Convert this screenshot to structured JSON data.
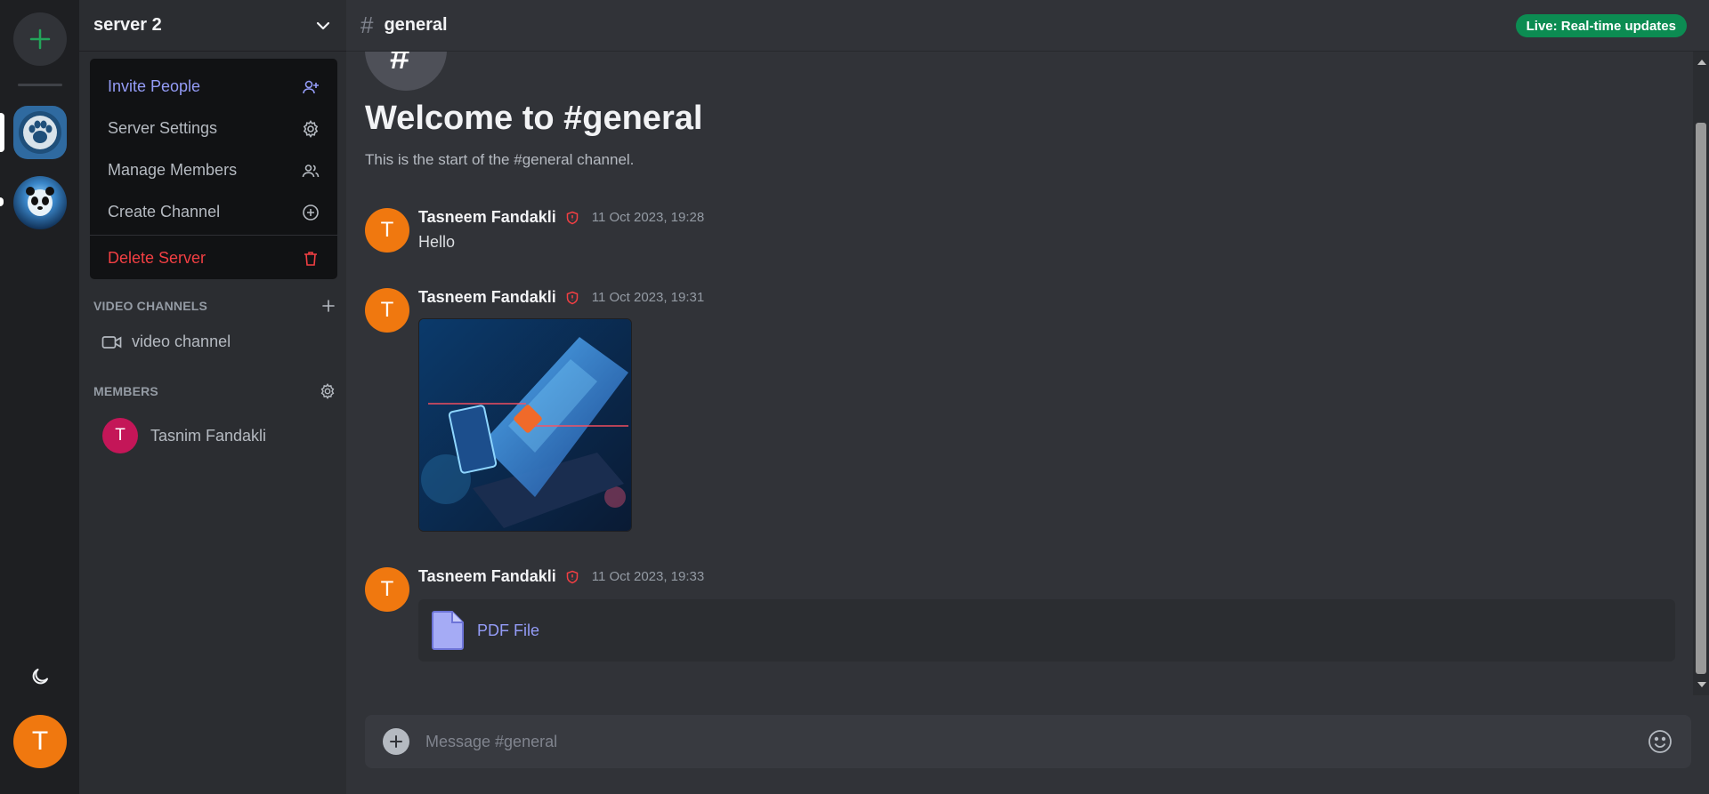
{
  "server": {
    "name": "server 2",
    "menu": {
      "invite": "Invite People",
      "settings": "Server Settings",
      "manage_members": "Manage Members",
      "create_channel": "Create Channel",
      "delete": "Delete Server"
    },
    "sections": {
      "video": "VIDEO CHANNELS",
      "members": "MEMBERS"
    },
    "video_channel": "video channel",
    "member": {
      "initial": "T",
      "name": "Tasnim Fandakli"
    }
  },
  "rail": {
    "user_initial": "T"
  },
  "channel": {
    "hash": "#",
    "name": "general",
    "live_badge": "Live: Real-time updates",
    "welcome_title": "Welcome to #general",
    "welcome_subtitle": "This is the start of the #general channel."
  },
  "messages": [
    {
      "initial": "T",
      "author": "Tasneem Fandakli",
      "time": "11 Oct 2023, 19:28",
      "text": "Hello"
    },
    {
      "initial": "T",
      "author": "Tasneem Fandakli",
      "time": "11 Oct 2023, 19:31",
      "text": ""
    },
    {
      "initial": "T",
      "author": "Tasneem Fandakli",
      "time": "11 Oct 2023, 19:33",
      "file_label": "PDF File"
    }
  ],
  "composer": {
    "placeholder": "Message #general"
  },
  "colors": {
    "accent": "#949cf7",
    "danger": "#f23f43",
    "live": "#0c8c52",
    "avatar_orange": "#f0780f",
    "member_avatar": "#c41658"
  },
  "icons": [
    "plus-icon",
    "moon-icon",
    "chevron-down-icon",
    "user-plus-icon",
    "gear-icon",
    "users-icon",
    "plus-circle-icon",
    "trash-icon",
    "video-icon",
    "shield-icon",
    "file-icon",
    "emoji-icon"
  ]
}
